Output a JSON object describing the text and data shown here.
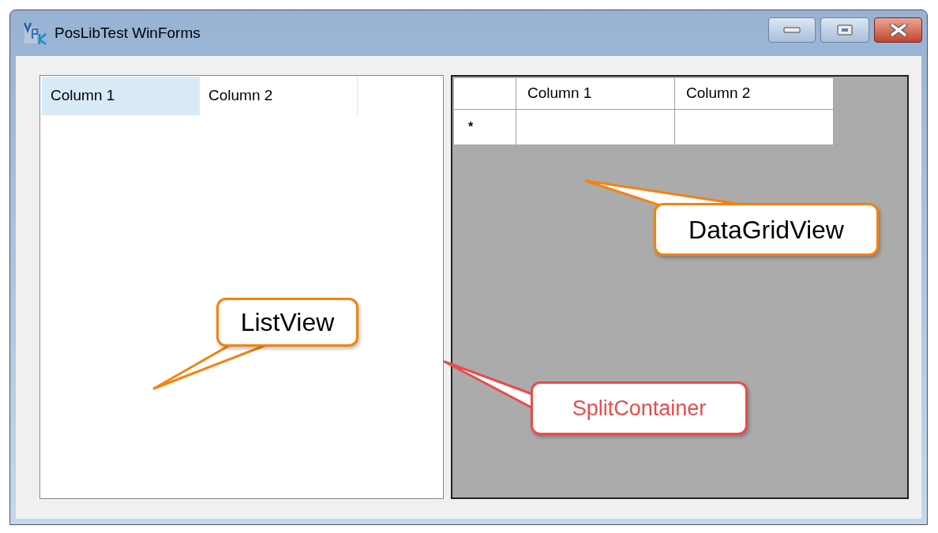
{
  "window": {
    "title": "PosLibTest WinForms"
  },
  "list_view": {
    "columns": [
      {
        "label": "Column 1",
        "hovered": true
      },
      {
        "label": "Column 2",
        "hovered": false
      }
    ]
  },
  "data_grid": {
    "columns": [
      "Column 1",
      "Column 2"
    ],
    "new_row_marker": "*"
  },
  "callouts": [
    {
      "text": "ListView",
      "color": "#f5820f"
    },
    {
      "text": "DataGridView",
      "color": "#f5820f"
    },
    {
      "text": "SplitContainer",
      "color": "#e84c4c"
    }
  ]
}
